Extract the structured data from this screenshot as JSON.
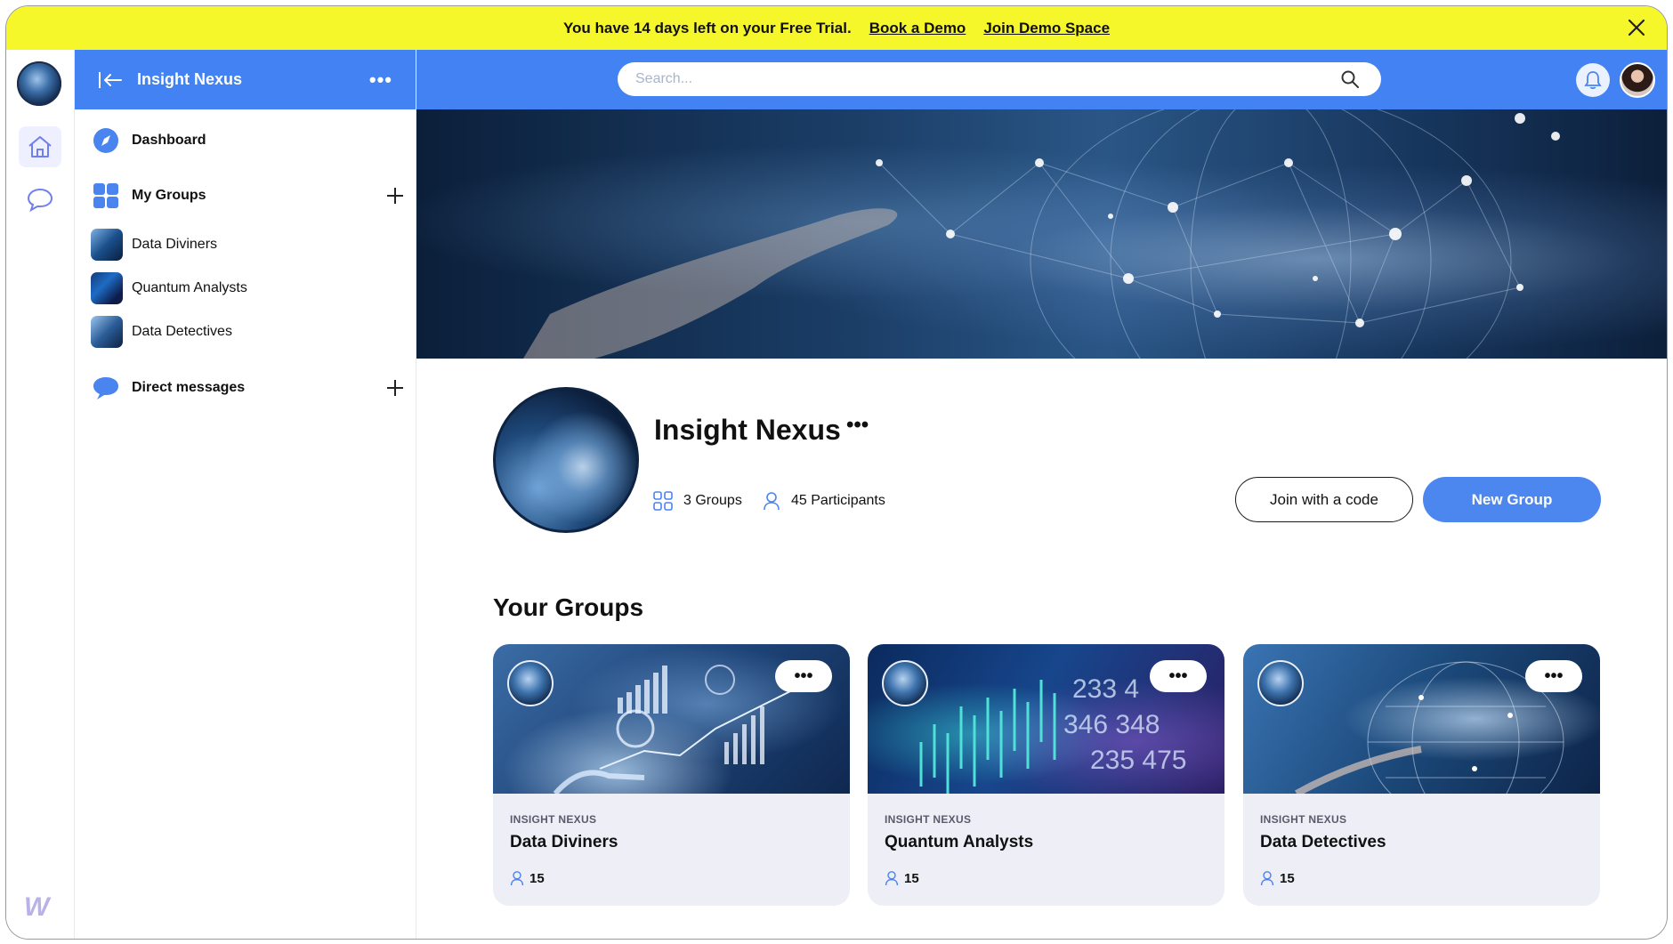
{
  "banner": {
    "message": "You have 14 days left on your Free Trial.",
    "book_demo": "Book a Demo",
    "join_demo": "Join Demo Space"
  },
  "sidebar": {
    "title": "Insight Nexus",
    "dashboard": "Dashboard",
    "my_groups": "My Groups",
    "groups": [
      {
        "label": "Data Diviners"
      },
      {
        "label": "Quantum Analysts"
      },
      {
        "label": "Data Detectives"
      }
    ],
    "direct_messages": "Direct messages"
  },
  "rail": {
    "brand": "W"
  },
  "search": {
    "placeholder": "Search..."
  },
  "profile": {
    "name": "Insight Nexus",
    "groups_count": "3 Groups",
    "participants_count": "45 Participants",
    "join_code": "Join with a code",
    "new_group": "New Group"
  },
  "your_groups": {
    "title": "Your Groups",
    "cards": [
      {
        "kicker": "INSIGHT NEXUS",
        "name": "Data Diviners",
        "members": "15"
      },
      {
        "kicker": "INSIGHT NEXUS",
        "name": "Quantum Analysts",
        "members": "15"
      },
      {
        "kicker": "INSIGHT NEXUS",
        "name": "Data Detectives",
        "members": "15"
      }
    ]
  },
  "colors": {
    "banner": "#f6f72b",
    "primary": "#4282f3",
    "button": "#4c86ef"
  },
  "icons": [
    "close-icon",
    "home-icon",
    "chat-icon",
    "back-arrow-icon",
    "compass-icon",
    "grid-icon",
    "plus-icon",
    "message-bubble-icon",
    "search-icon",
    "bell-icon",
    "groups-grid-icon",
    "person-icon"
  ]
}
